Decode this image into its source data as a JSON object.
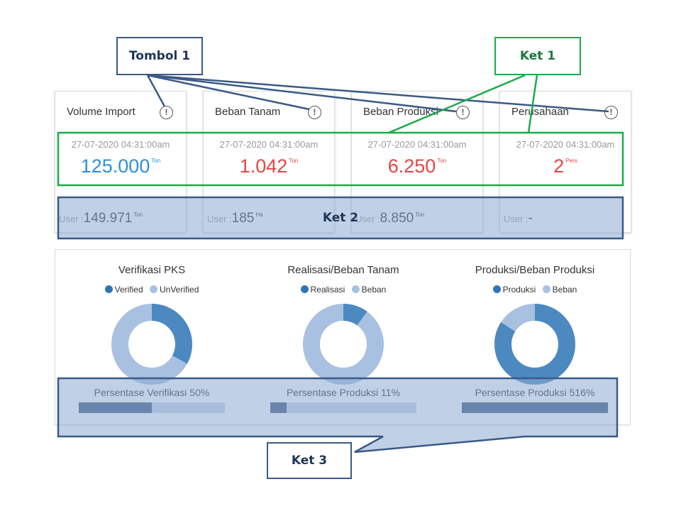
{
  "cards": [
    {
      "title": "Volume Import",
      "date": "27-07-2020 04:31:00am",
      "value": "125.000",
      "unit": "Ton",
      "color": "#2e8fd8",
      "user_label": "User :",
      "user_value": "149.971",
      "user_unit": "Ton"
    },
    {
      "title": "Beban Tanam",
      "date": "27-07-2020 04:31:00am",
      "value": "1.042",
      "unit": "Ton",
      "color": "#e84444",
      "user_label": "User :",
      "user_value": "185",
      "user_unit": "Ha"
    },
    {
      "title": "Beban Produksi",
      "date": "27-07-2020 04:31:00am",
      "value": "6.250",
      "unit": "Ton",
      "color": "#e84444",
      "user_label": "User :",
      "user_value": "8.850",
      "user_unit": "Ton"
    },
    {
      "title": "Perusahaan",
      "date": "27-07-2020 04:31:00am",
      "value": "2",
      "unit": "Pers",
      "color": "#e84444",
      "user_label": "User :",
      "user_value": "-",
      "user_unit": ""
    }
  ],
  "info_icon": {
    "icon": "info-circle-icon",
    "glyph": "!"
  },
  "charts": [
    {
      "title": "Verifikasi PKS",
      "legend": [
        "Verified",
        "UnVerified"
      ],
      "colors": [
        "#2e75b6",
        "#a8c1e1"
      ],
      "first_share": 0.33,
      "percent_label": "Persentase Verifikasi 50%",
      "bar_fill": 0.5
    },
    {
      "title": "Realisasi/Beban Tanam",
      "legend": [
        "Realisasi",
        "Beban"
      ],
      "colors": [
        "#2e75b6",
        "#a8c1e1"
      ],
      "first_share": 0.1,
      "percent_label": "Persentase Produksi 11%",
      "bar_fill": 0.11
    },
    {
      "title": "Produksi/Beban Produksi",
      "legend": [
        "Produksi",
        "Beban"
      ],
      "colors": [
        "#2e75b6",
        "#a8c1e1"
      ],
      "first_share": 0.84,
      "percent_label": "Persentase Produksi 516%",
      "bar_fill": 1.0
    }
  ],
  "annotations": {
    "tombol1": "Tombol 1",
    "ket1": "Ket 1",
    "ket2": "Ket 2",
    "ket3": "Ket 3",
    "colors": {
      "blue": "#3a5a86",
      "green": "#1aab4a",
      "blue_fill": "rgba(140,170,210,0.55)"
    }
  }
}
